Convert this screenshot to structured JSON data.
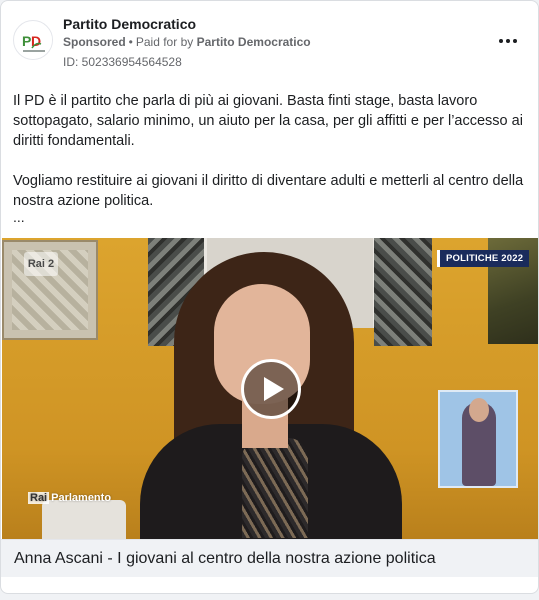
{
  "ad": {
    "page_name": "Partito Democratico",
    "avatar_text": "PD",
    "sponsored_label": "Sponsored",
    "separator": "•",
    "paid_for_prefix": "Paid for by",
    "paid_for_name": "Partito Democratico",
    "id_text": "ID: 502336954564528",
    "more_icon": "more-horizontal-icon"
  },
  "body": {
    "paragraph1": "Il PD è il partito che parla di più ai giovani. Basta finti stage, basta lavoro sottopagato, salario minimo, un aiuto per la casa, per gli affitti e per l’accesso ai diritti fondamentali.",
    "paragraph2": "Vogliamo restituire ai giovani il diritto di diventare adulti e metterli al centro della nostra azione politica.",
    "ellipsis": "..."
  },
  "video": {
    "badge": "POLITICHE 2022",
    "channel_logo": "Rai 2",
    "bottom_logo_prefix": "Rai",
    "bottom_logo_suffix": "Parlamento",
    "play_icon": "play-icon"
  },
  "caption": {
    "title": "Anna Ascani - I giovani al centro della nostra azione politica"
  },
  "colors": {
    "pd_green": "#3f8f3a",
    "pd_red": "#d7261e",
    "badge_navy": "#1a2b5c"
  }
}
